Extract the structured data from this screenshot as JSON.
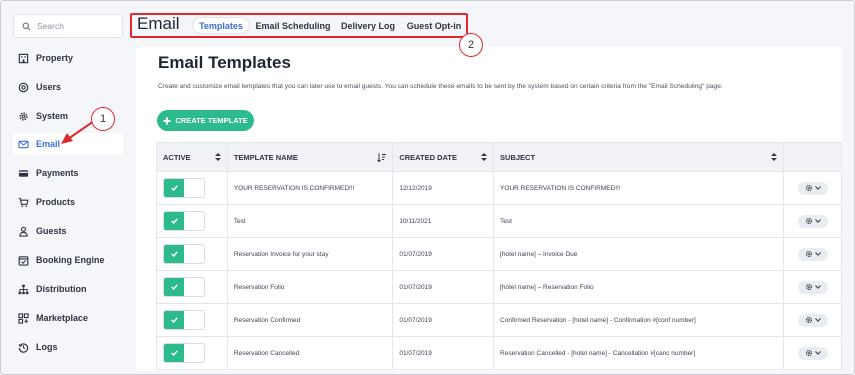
{
  "search": {
    "placeholder": "Search"
  },
  "sidebar": {
    "items": [
      {
        "label": "Property",
        "icon": "building-icon"
      },
      {
        "label": "Users",
        "icon": "at-icon"
      },
      {
        "label": "System",
        "icon": "gear-icon"
      },
      {
        "label": "Email",
        "icon": "envelope-icon",
        "active": true
      },
      {
        "label": "Payments",
        "icon": "credit-card-icon"
      },
      {
        "label": "Products",
        "icon": "cart-icon"
      },
      {
        "label": "Guests",
        "icon": "person-icon"
      },
      {
        "label": "Booking Engine",
        "icon": "calendar-check-icon"
      },
      {
        "label": "Distribution",
        "icon": "sitemap-icon"
      },
      {
        "label": "Marketplace",
        "icon": "apps-icon"
      },
      {
        "label": "Logs",
        "icon": "history-icon"
      }
    ]
  },
  "header": {
    "title": "Email",
    "tabs": [
      {
        "label": "Templates",
        "active": true
      },
      {
        "label": "Email Scheduling"
      },
      {
        "label": "Delivery Log"
      },
      {
        "label": "Guest Opt-in"
      }
    ]
  },
  "annotations": {
    "callout_1": "1",
    "callout_2": "2",
    "color": "#e0282e"
  },
  "main": {
    "title": "Email Templates",
    "description": "Create and customize email templates that you can later use to email guests. You can schedule these emails to be sent by the system based on certain criteria from the \"Email Scheduling\" page.",
    "create_button": "CREATE TEMPLATE",
    "create_button_color": "#2dbb8e"
  },
  "table": {
    "columns": [
      "ACTIVE",
      "TEMPLATE NAME",
      "CREATED DATE",
      "SUBJECT"
    ],
    "rows": [
      {
        "active": true,
        "name": "YOUR RESERVATION IS CONFIRMED!!!",
        "created": "12/12/2019",
        "subject": "YOUR RESERVATION IS CONFIRMED!!!"
      },
      {
        "active": true,
        "name": "Test",
        "created": "10/11/2021",
        "subject": "Test"
      },
      {
        "active": true,
        "name": "Reservation Invoice for your stay",
        "created": "01/07/2019",
        "subject": "[hotel name] – Invoice Due"
      },
      {
        "active": true,
        "name": "Reservation Folio",
        "created": "01/07/2019",
        "subject": "[hotel name] – Reservation Folio"
      },
      {
        "active": true,
        "name": "Reservation Confirmed",
        "created": "01/07/2019",
        "subject": "Confirmed Reservation - [hotel name] - Confirmation #[conf number]"
      },
      {
        "active": true,
        "name": "Reservation Cancelled",
        "created": "01/07/2019",
        "subject": "Reservation Cancelled - [hotel name] - Cancellation #[canc number]"
      }
    ]
  }
}
